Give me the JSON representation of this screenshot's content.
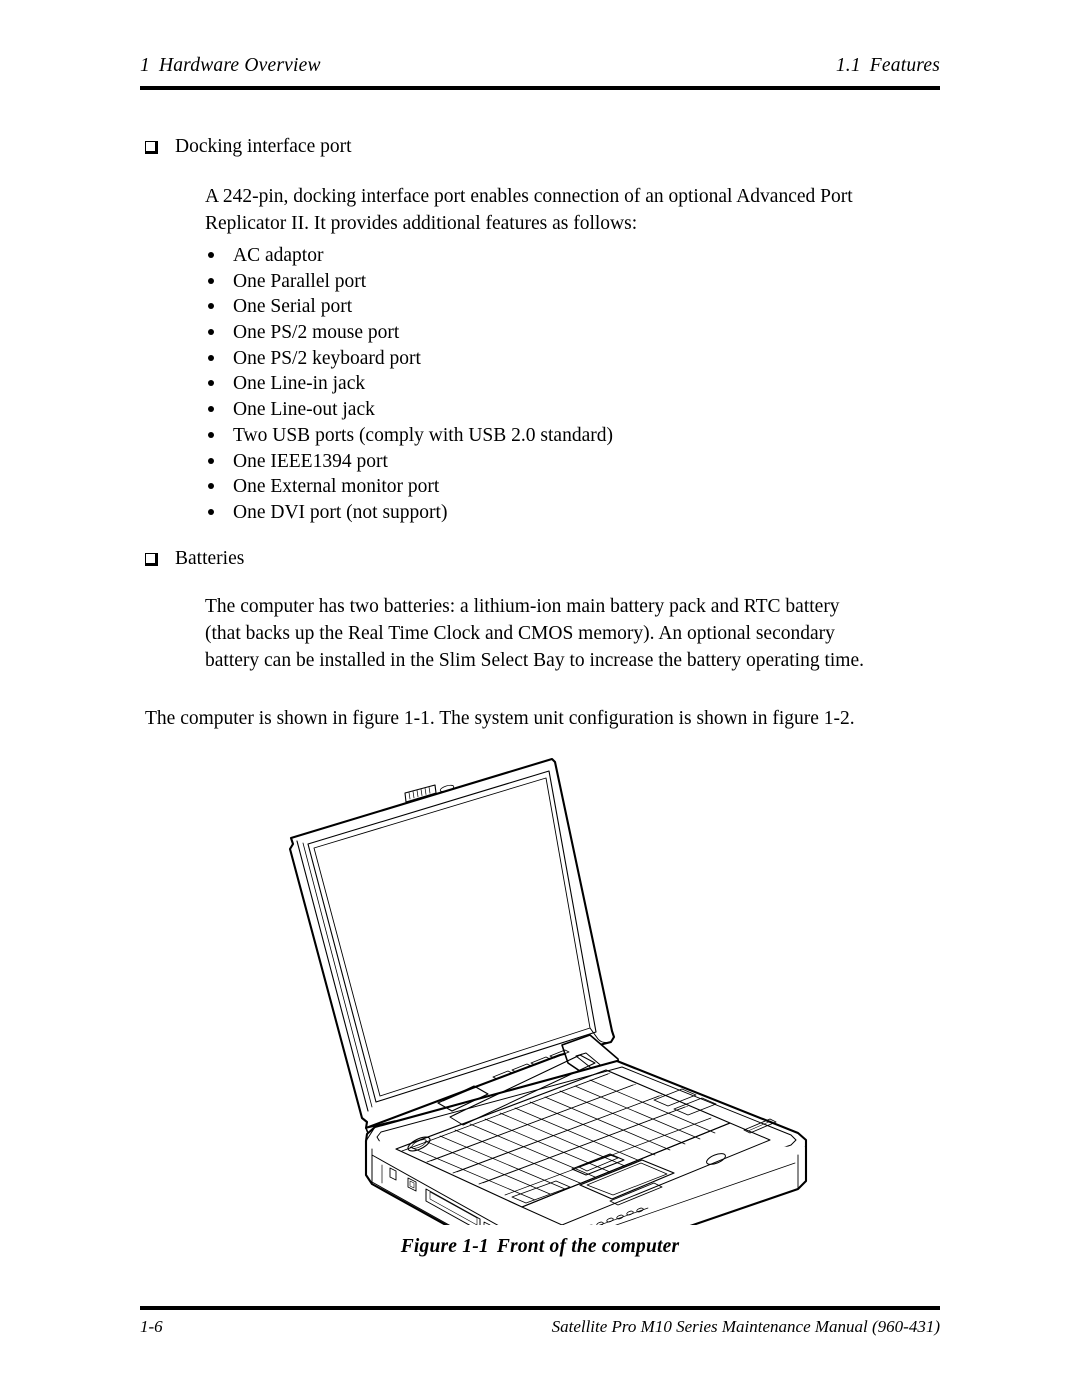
{
  "header": {
    "left_number": "1",
    "left_title": "Hardware Overview",
    "right_number": "1.1",
    "right_title": "Features"
  },
  "sections": [
    {
      "heading": "Docking interface port",
      "paragraph_lines": [
        "A 242-pin, docking interface port enables connection of an optional Advanced Port",
        "Replicator II. It provides additional features as follows:"
      ],
      "bullets": [
        "AC adaptor",
        "One Parallel port",
        "One Serial port",
        "One PS/2 mouse port",
        "One PS/2 keyboard port",
        "One Line-in jack",
        "One Line-out jack",
        "Two USB ports (comply with USB 2.0 standard)",
        "One IEEE1394 port",
        "One External monitor port",
        "One DVI port (not support)"
      ]
    },
    {
      "heading": "Batteries",
      "paragraph_lines": [
        "The computer has two batteries: a lithium-ion main battery pack and RTC battery",
        "(that backs up the Real Time Clock and CMOS memory). An optional secondary",
        "battery can be installed in the Slim Select Bay to increase the battery operating time."
      ]
    }
  ],
  "closing_paragraph": "The computer is shown in figure 1-1. The system unit configuration is shown in figure 1-2.",
  "figure": {
    "number": "Figure 1-1",
    "title": "Front of the computer",
    "illustration": "laptop-front-line-drawing"
  },
  "footer": {
    "page_number": "1-6",
    "manual_title": "Satellite Pro M10 Series Maintenance Manual (960-431)"
  },
  "colors": {
    "page_background": "#ffffff",
    "text": "#000000",
    "rule": "#000000"
  }
}
